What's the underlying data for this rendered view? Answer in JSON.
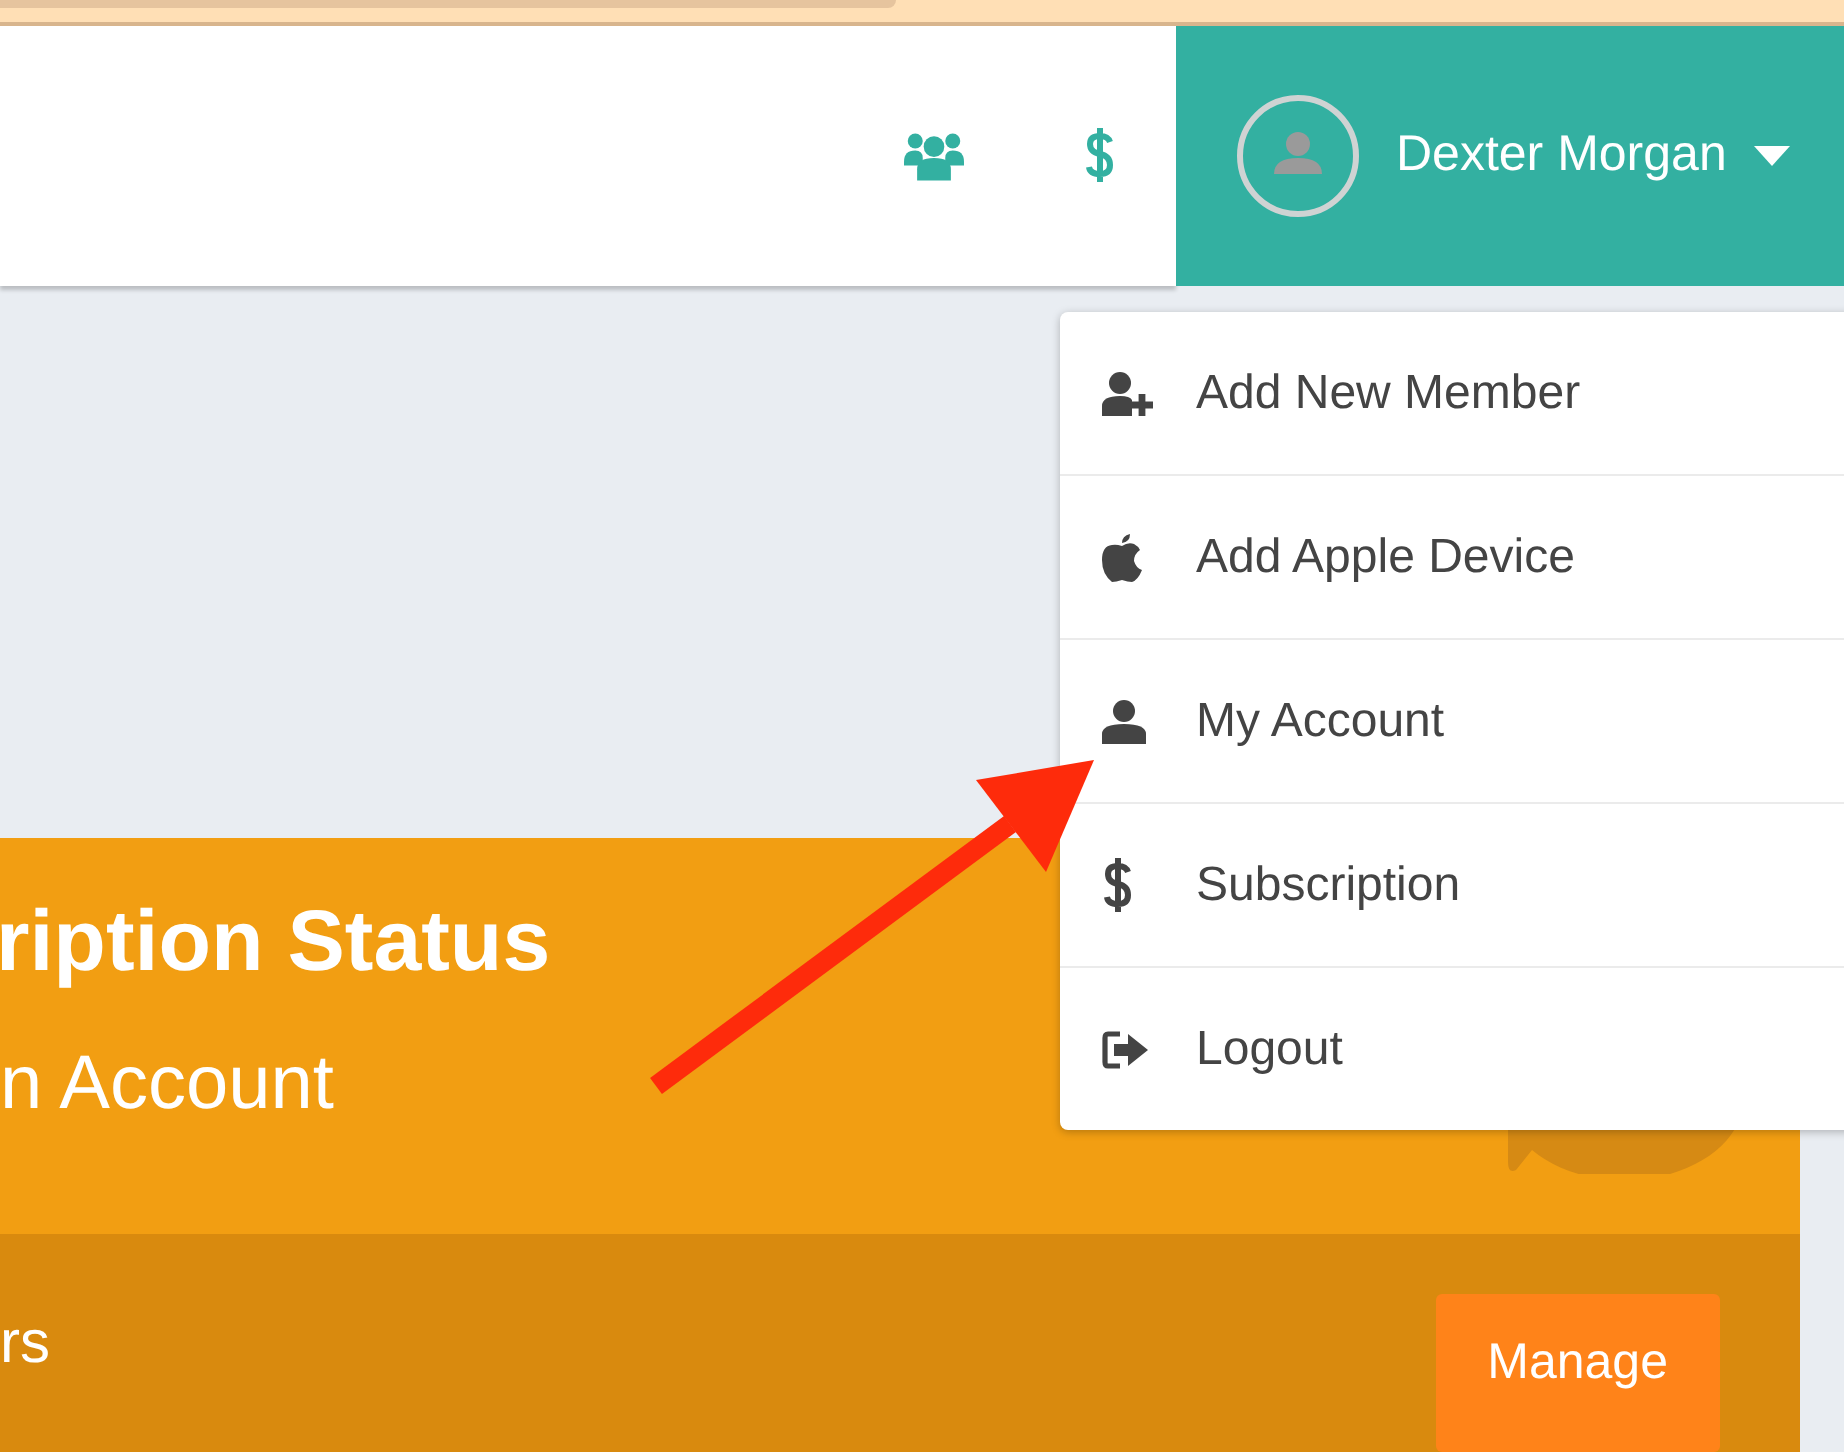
{
  "header": {
    "user": {
      "name": "Dexter Morgan"
    }
  },
  "user_menu": {
    "expanded": true,
    "items": [
      {
        "kind": "add-member",
        "label": "Add New Member"
      },
      {
        "kind": "apple",
        "label": "Add Apple Device"
      },
      {
        "kind": "account",
        "label": "My Account"
      },
      {
        "kind": "subscription",
        "label": "Subscription"
      },
      {
        "kind": "logout",
        "label": "Logout"
      }
    ]
  },
  "status_card": {
    "title": "ription Status",
    "subtitle": "n Account",
    "footer_text": "rs",
    "button": "Manage"
  }
}
